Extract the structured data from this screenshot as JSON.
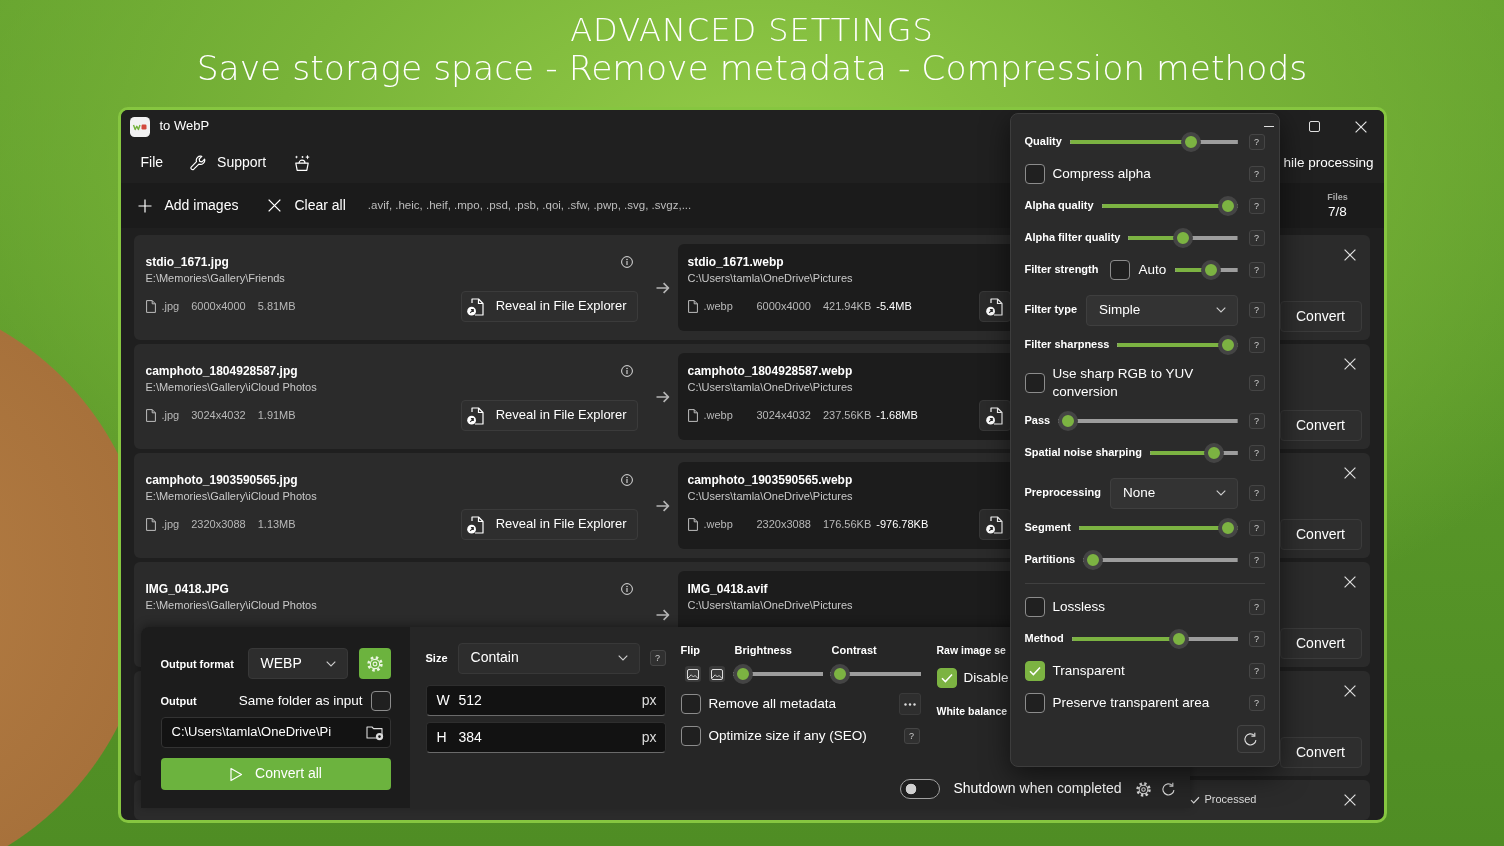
{
  "header": {
    "title": "ADVANCED SETTINGS",
    "subtitle": "Save storage space - Remove metadata - Compression methods"
  },
  "window": {
    "title": "to WebP"
  },
  "menu": {
    "items": [
      {
        "kind": "text",
        "label": "File"
      },
      {
        "kind": "tool",
        "label": "Support"
      },
      {
        "kind": "icon"
      }
    ],
    "trailing": "hile processing"
  },
  "toolbar": {
    "actions": [
      {
        "kind": "add",
        "label": "Add images"
      },
      {
        "kind": "clear",
        "label": "Clear all"
      }
    ],
    "formats": ".avif, .heic, .heif, .mpo, .psd, .psb, .qoi, .sfw, .pwp, .svg, .svgz,...",
    "stats": [
      {
        "label": "Files",
        "value": "7/8"
      }
    ]
  },
  "files": [
    {
      "source": {
        "name": "stdio_1671.jpg",
        "path": "E:\\Memories\\Gallery\\Friends",
        "ext": ".jpg",
        "dimensions": "6000x4000",
        "size": "5.81MB",
        "reveal": "Reveal in File Explorer"
      },
      "output": {
        "name": "stdio_1671.webp",
        "path": "C:\\Users\\tamla\\OneDrive\\Pictures",
        "ext": ".webp",
        "dimensions": "6000x4000",
        "size": "421.94KB",
        "saved": "-5.4MB"
      },
      "action": "Convert"
    },
    {
      "source": {
        "name": "camphoto_1804928587.jpg",
        "path": "E:\\Memories\\Gallery\\iCloud Photos",
        "ext": ".jpg",
        "dimensions": "3024x4032",
        "size": "1.91MB",
        "reveal": "Reveal in File Explorer"
      },
      "output": {
        "name": "camphoto_1804928587.webp",
        "path": "C:\\Users\\tamla\\OneDrive\\Pictures",
        "ext": ".webp",
        "dimensions": "3024x4032",
        "size": "237.56KB",
        "saved": "-1.68MB"
      },
      "action": "Convert"
    },
    {
      "source": {
        "name": "camphoto_1903590565.jpg",
        "path": "E:\\Memories\\Gallery\\iCloud Photos",
        "ext": ".jpg",
        "dimensions": "2320x3088",
        "size": "1.13MB",
        "reveal": "Reveal in File Explorer"
      },
      "output": {
        "name": "camphoto_1903590565.webp",
        "path": "C:\\Users\\tamla\\OneDrive\\Pictures",
        "ext": ".webp",
        "dimensions": "2320x3088",
        "size": "176.56KB",
        "saved": "-976.78KB"
      },
      "action": "Convert"
    },
    {
      "source": {
        "name": "IMG_0418.JPG",
        "path": "E:\\Memories\\Gallery\\iCloud Photos"
      },
      "output": {
        "name": "IMG_0418.avif",
        "path": "C:\\Users\\tamla\\OneDrive\\Pictures"
      },
      "action": "Convert"
    },
    {
      "action": "Convert"
    },
    {
      "status": "Processed"
    }
  ],
  "output_panel": {
    "format": {
      "label": "Output format",
      "value": "WEBP"
    },
    "output": {
      "label": "Output",
      "same_folder": {
        "label": "Same folder as input",
        "checked": false
      },
      "path": "C:\\Users\\tamla\\OneDrive\\Pi"
    },
    "convert_all": "Convert all",
    "size": {
      "label": "Size",
      "mode": "Contain",
      "help": "?",
      "fields": [
        {
          "letter": "W",
          "value": "512",
          "unit": "px"
        },
        {
          "letter": "H",
          "value": "384",
          "unit": "px"
        }
      ]
    },
    "flip": {
      "label": "Flip"
    },
    "sliders": [
      {
        "label": "Brightness",
        "level": 0
      },
      {
        "label": "Contrast",
        "level": 0
      }
    ],
    "options": [
      {
        "kind": "more",
        "label": "Remove all metadata",
        "checked": false
      },
      {
        "kind": "help",
        "label": "Optimize size if any (SEO)",
        "checked": false,
        "help": "?"
      }
    ],
    "raw": {
      "label": "Raw image se",
      "disable": {
        "label": "Disable",
        "checked": true
      },
      "white_balance": "White balance"
    },
    "shutdown": {
      "label": "Shutdown when completed",
      "on": false
    }
  },
  "settings": {
    "sections": [
      {
        "rows": [
          {
            "kind": "slider",
            "label": "Quality",
            "level": 0.75,
            "help": "?"
          },
          {
            "kind": "check",
            "label": "Compress alpha",
            "checked": false,
            "help": "?"
          },
          {
            "kind": "slider",
            "label": "Alpha quality",
            "level": 1,
            "help": "?"
          },
          {
            "kind": "slider",
            "label": "Alpha filter quality",
            "level": 0.5,
            "help": "?"
          },
          {
            "kind": "auto",
            "label": "Filter strength",
            "auto": {
              "label": "Auto",
              "checked": false
            },
            "level": 0.6,
            "help": "?"
          },
          {
            "kind": "select",
            "label": "Filter type",
            "value": "Simple",
            "help": "?"
          },
          {
            "kind": "slider",
            "label": "Filter sharpness",
            "level": 1,
            "help": "?"
          },
          {
            "kind": "check",
            "label": "Use sharp RGB to YUV conversion",
            "checked": false,
            "help": "?"
          },
          {
            "kind": "slider",
            "label": "Pass",
            "level": 0,
            "help": "?"
          },
          {
            "kind": "slider",
            "label": "Spatial noise sharping",
            "level": 0.8,
            "help": "?"
          },
          {
            "kind": "select",
            "label": "Preprocessing",
            "value": "None",
            "help": "?"
          },
          {
            "kind": "slider",
            "label": "Segment",
            "level": 1,
            "help": "?"
          },
          {
            "kind": "slider",
            "label": "Partitions",
            "level": 0,
            "help": "?"
          }
        ]
      },
      {
        "rows": [
          {
            "kind": "check",
            "label": "Lossless",
            "checked": false,
            "help": "?"
          },
          {
            "kind": "slider",
            "label": "Method",
            "level": 0.67,
            "help": "?"
          },
          {
            "kind": "check",
            "label": "Transparent",
            "checked": true,
            "help": "?"
          },
          {
            "kind": "check",
            "label": "Preserve transparent area",
            "checked": false,
            "help": "?"
          }
        ]
      }
    ]
  }
}
